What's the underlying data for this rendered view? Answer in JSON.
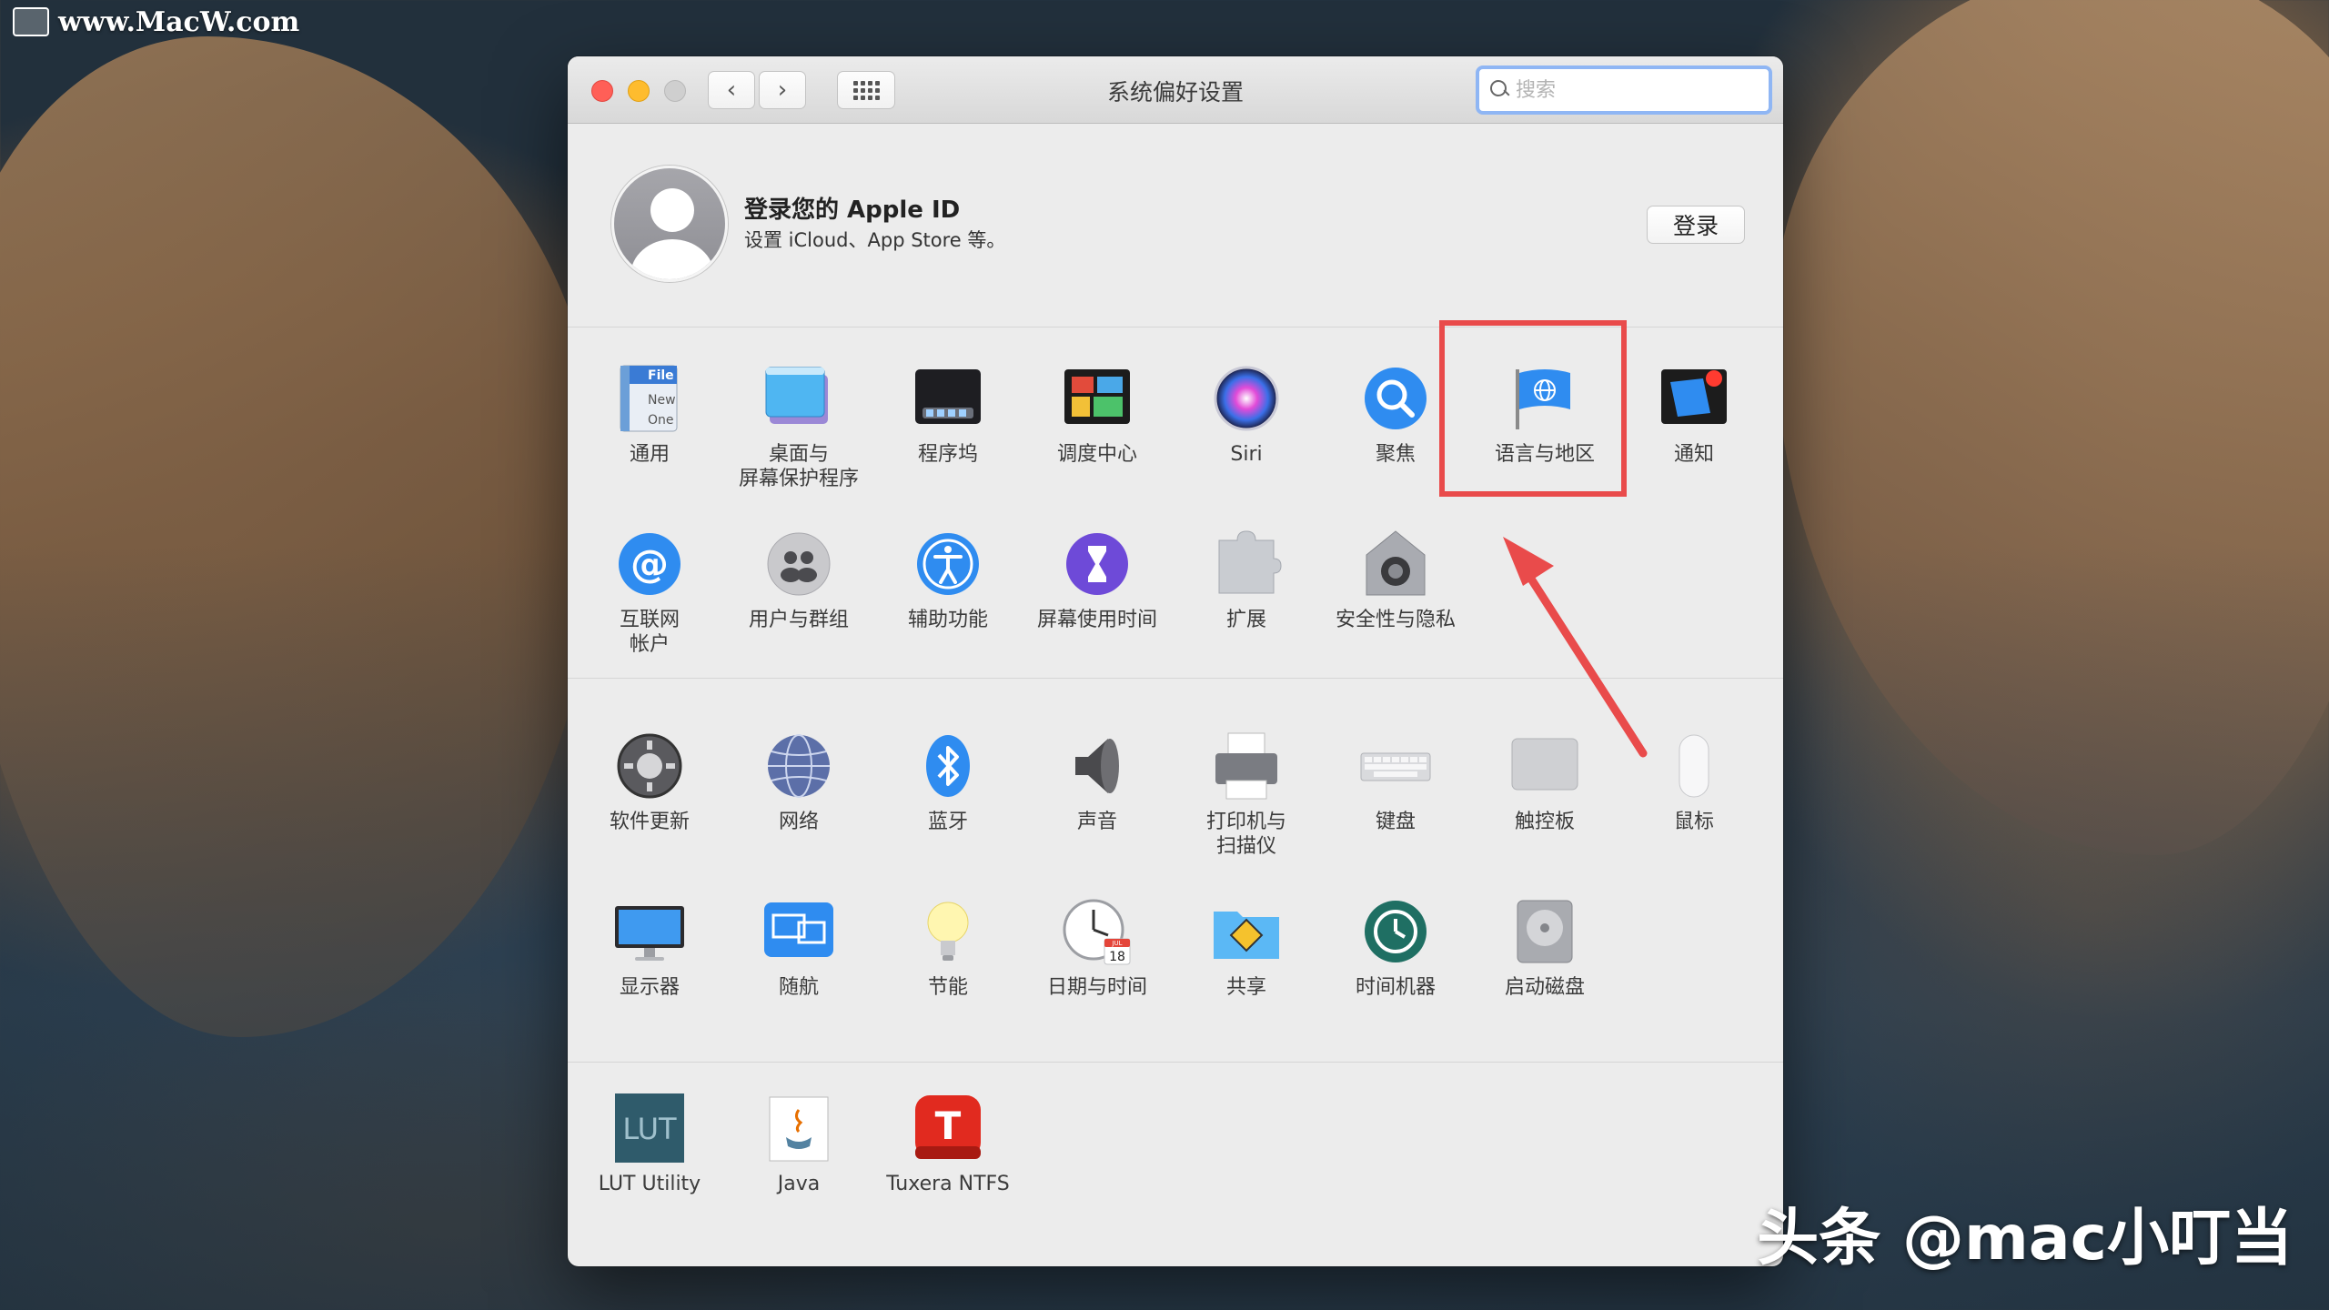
{
  "watermark": {
    "text": "www.MacW.com"
  },
  "credit": {
    "text": "头条 @mac小叮当"
  },
  "window": {
    "title": "系统偏好设置",
    "search_placeholder": "搜索"
  },
  "apple_id": {
    "heading": "登录您的 Apple ID",
    "subtitle": "设置 iCloud、App Store 等。",
    "login_label": "登录"
  },
  "section1": {
    "items": [
      {
        "label": "通用",
        "icon": "general-icon"
      },
      {
        "label": "桌面与\n屏幕保护程序",
        "icon": "desktop-icon"
      },
      {
        "label": "程序坞",
        "icon": "dock-icon"
      },
      {
        "label": "调度中心",
        "icon": "mission-control-icon"
      },
      {
        "label": "Siri",
        "icon": "siri-icon"
      },
      {
        "label": "聚焦",
        "icon": "spotlight-icon"
      },
      {
        "label": "语言与地区",
        "icon": "language-region-icon"
      },
      {
        "label": "通知",
        "icon": "notifications-icon"
      },
      {
        "label": "互联网\n帐户",
        "icon": "internet-accounts-icon"
      },
      {
        "label": "用户与群组",
        "icon": "users-groups-icon"
      },
      {
        "label": "辅助功能",
        "icon": "accessibility-icon"
      },
      {
        "label": "屏幕使用时间",
        "icon": "screen-time-icon"
      },
      {
        "label": "扩展",
        "icon": "extensions-icon"
      },
      {
        "label": "安全性与隐私",
        "icon": "security-icon"
      }
    ]
  },
  "section2": {
    "items": [
      {
        "label": "软件更新",
        "icon": "software-update-icon"
      },
      {
        "label": "网络",
        "icon": "network-icon"
      },
      {
        "label": "蓝牙",
        "icon": "bluetooth-icon"
      },
      {
        "label": "声音",
        "icon": "sound-icon"
      },
      {
        "label": "打印机与\n扫描仪",
        "icon": "printer-icon"
      },
      {
        "label": "键盘",
        "icon": "keyboard-icon"
      },
      {
        "label": "触控板",
        "icon": "trackpad-icon"
      },
      {
        "label": "鼠标",
        "icon": "mouse-icon"
      },
      {
        "label": "显示器",
        "icon": "displays-icon"
      },
      {
        "label": "随航",
        "icon": "sidecar-icon"
      },
      {
        "label": "节能",
        "icon": "energy-saver-icon"
      },
      {
        "label": "日期与时间",
        "icon": "date-time-icon"
      },
      {
        "label": "共享",
        "icon": "sharing-icon"
      },
      {
        "label": "时间机器",
        "icon": "time-machine-icon"
      },
      {
        "label": "启动磁盘",
        "icon": "startup-disk-icon"
      }
    ]
  },
  "section3": {
    "items": [
      {
        "label": "LUT Utility",
        "icon": "lut-utility-icon",
        "icon_text": "LUT"
      },
      {
        "label": "Java",
        "icon": "java-icon"
      },
      {
        "label": "Tuxera NTFS",
        "icon": "tuxera-ntfs-icon",
        "icon_text": "T"
      }
    ]
  },
  "icon_text": {
    "general_file": "File",
    "general_new": "New",
    "general_one": "One",
    "date_month": "JUL",
    "date_day": "18"
  },
  "colors": {
    "highlight": "#e94b4b",
    "traffic_close": "#ff5f57",
    "traffic_min": "#febc2e",
    "search_focus": "#8fb6f4"
  }
}
